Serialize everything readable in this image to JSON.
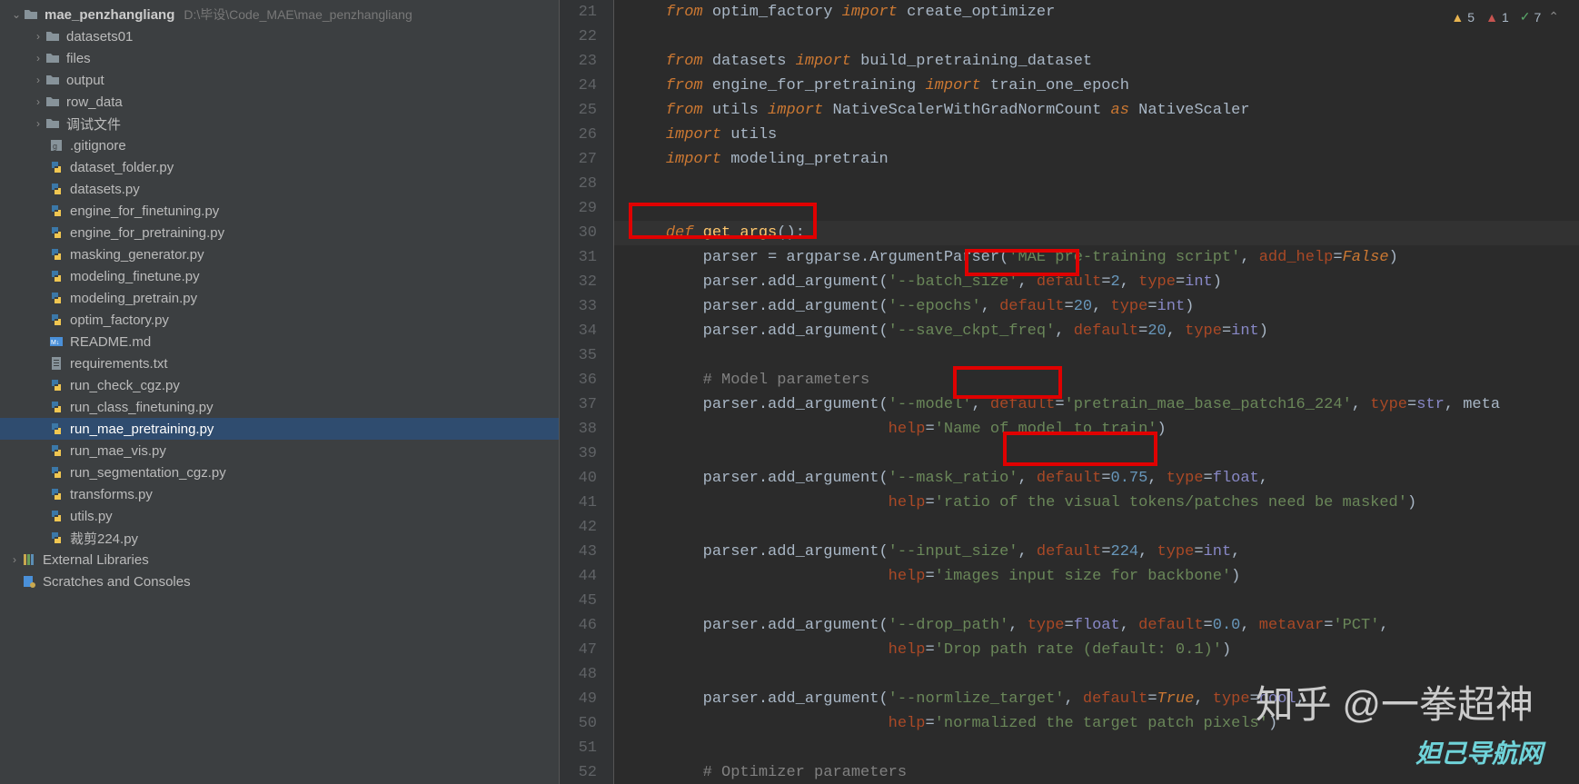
{
  "project": {
    "name": "mae_penzhangliang",
    "path": "D:\\毕设\\Code_MAE\\mae_penzhangliang"
  },
  "tree": [
    {
      "type": "folder",
      "name": "datasets01",
      "depth": 1,
      "open": false
    },
    {
      "type": "folder",
      "name": "files",
      "depth": 1,
      "open": false
    },
    {
      "type": "folder",
      "name": "output",
      "depth": 1,
      "open": false
    },
    {
      "type": "folder",
      "name": "row_data",
      "depth": 1,
      "open": false
    },
    {
      "type": "folder",
      "name": "调试文件",
      "depth": 1,
      "open": false
    },
    {
      "type": "file",
      "name": ".gitignore",
      "depth": 2,
      "icon": "git"
    },
    {
      "type": "file",
      "name": "dataset_folder.py",
      "depth": 2,
      "icon": "py"
    },
    {
      "type": "file",
      "name": "datasets.py",
      "depth": 2,
      "icon": "py"
    },
    {
      "type": "file",
      "name": "engine_for_finetuning.py",
      "depth": 2,
      "icon": "py"
    },
    {
      "type": "file",
      "name": "engine_for_pretraining.py",
      "depth": 2,
      "icon": "py"
    },
    {
      "type": "file",
      "name": "masking_generator.py",
      "depth": 2,
      "icon": "py"
    },
    {
      "type": "file",
      "name": "modeling_finetune.py",
      "depth": 2,
      "icon": "py"
    },
    {
      "type": "file",
      "name": "modeling_pretrain.py",
      "depth": 2,
      "icon": "py"
    },
    {
      "type": "file",
      "name": "optim_factory.py",
      "depth": 2,
      "icon": "py"
    },
    {
      "type": "file",
      "name": "README.md",
      "depth": 2,
      "icon": "md"
    },
    {
      "type": "file",
      "name": "requirements.txt",
      "depth": 2,
      "icon": "txt"
    },
    {
      "type": "file",
      "name": "run_check_cgz.py",
      "depth": 2,
      "icon": "py"
    },
    {
      "type": "file",
      "name": "run_class_finetuning.py",
      "depth": 2,
      "icon": "py"
    },
    {
      "type": "file",
      "name": "run_mae_pretraining.py",
      "depth": 2,
      "icon": "py",
      "selected": true
    },
    {
      "type": "file",
      "name": "run_mae_vis.py",
      "depth": 2,
      "icon": "py"
    },
    {
      "type": "file",
      "name": "run_segmentation_cgz.py",
      "depth": 2,
      "icon": "py"
    },
    {
      "type": "file",
      "name": "transforms.py",
      "depth": 2,
      "icon": "py"
    },
    {
      "type": "file",
      "name": "utils.py",
      "depth": 2,
      "icon": "py"
    },
    {
      "type": "file",
      "name": "裁剪224.py",
      "depth": 2,
      "icon": "py"
    }
  ],
  "tree_tail": [
    {
      "name": "External Libraries",
      "icon": "lib"
    },
    {
      "name": "Scratches and Consoles",
      "icon": "scratch"
    }
  ],
  "status": {
    "warn": "5",
    "err": "1",
    "ok": "7"
  },
  "lines": {
    "start": 21,
    "count": 32
  },
  "code": {
    "l21a": "    ",
    "l21b": "from",
    "l21c": " optim_factory ",
    "l21d": "import",
    "l21e": " create_optimizer",
    "l23a": "    ",
    "l23b": "from",
    "l23c": " datasets ",
    "l23d": "import",
    "l23e": " build_pretraining_dataset",
    "l24a": "    ",
    "l24b": "from",
    "l24c": " engine_for_pretraining ",
    "l24d": "import",
    "l24e": " train_one_epoch",
    "l25a": "    ",
    "l25b": "from",
    "l25c": " utils ",
    "l25d": "import",
    "l25e": " NativeScalerWithGradNormCount ",
    "l25f": "as",
    "l25g": " NativeScaler",
    "l26a": "    ",
    "l26b": "import",
    "l26c": " utils",
    "l27a": "    ",
    "l27b": "import",
    "l27c": " modeling_pretrain",
    "l30a": "    ",
    "l30b": "def ",
    "l30c": "get_args",
    "l30d": "():",
    "l31a": "        parser = argparse.ArgumentParser(",
    "l31b": "'MAE pre-training script'",
    "l31c": ", ",
    "l31d": "add_help",
    "l31e": "=",
    "l31f": "False",
    "l31g": ")",
    "l32a": "        parser.add_argument(",
    "l32b": "'--batch_size'",
    "l32c": ", ",
    "l32d": "default",
    "l32e": "=",
    "l32f": "2",
    "l32g": ", ",
    "l32h": "type",
    "l32i": "=",
    "l32j": "int",
    "l32k": ")",
    "l33a": "        parser.add_argument(",
    "l33b": "'--epochs'",
    "l33c": ", ",
    "l33d": "default",
    "l33e": "=",
    "l33f": "20",
    "l33g": ", ",
    "l33h": "type",
    "l33i": "=",
    "l33j": "int",
    "l33k": ")",
    "l34a": "        parser.add_argument(",
    "l34b": "'--save_ckpt_freq'",
    "l34c": ", ",
    "l34d": "default",
    "l34e": "=",
    "l34f": "20",
    "l34g": ", ",
    "l34h": "type",
    "l34i": "=",
    "l34j": "int",
    "l34k": ")",
    "l36a": "        ",
    "l36b": "# Model parameters",
    "l37a": "        parser.add_argument(",
    "l37b": "'--model'",
    "l37c": ", ",
    "l37d": "default",
    "l37e": "=",
    "l37f": "'pretrain_mae_base_patch16_224'",
    "l37g": ", ",
    "l37h": "type",
    "l37i": "=",
    "l37j": "str",
    "l37k": ", meta",
    "l38a": "                            ",
    "l38b": "help",
    "l38c": "=",
    "l38d": "'Name of model to train'",
    "l38e": ")",
    "l40a": "        parser.add_argument(",
    "l40b": "'--mask_ratio'",
    "l40c": ", ",
    "l40d": "default",
    "l40e": "=",
    "l40f": "0.75",
    "l40g": ", ",
    "l40h": "type",
    "l40i": "=",
    "l40j": "float",
    "l40k": ",",
    "l41a": "                            ",
    "l41b": "help",
    "l41c": "=",
    "l41d": "'ratio of the visual tokens/patches need be masked'",
    "l41e": ")",
    "l43a": "        parser.add_argument(",
    "l43b": "'--input_size'",
    "l43c": ", ",
    "l43d": "default",
    "l43e": "=",
    "l43f": "224",
    "l43g": ", ",
    "l43h": "type",
    "l43i": "=",
    "l43j": "int",
    "l43k": ",",
    "l44a": "                            ",
    "l44b": "help",
    "l44c": "=",
    "l44d": "'images input size for backbone'",
    "l44e": ")",
    "l46a": "        parser.add_argument(",
    "l46b": "'--drop_path'",
    "l46c": ", ",
    "l46d": "type",
    "l46e": "=",
    "l46f": "float",
    "l46g": ", ",
    "l46h": "default",
    "l46i": "=",
    "l46j": "0.0",
    "l46k": ", ",
    "l46l": "metavar",
    "l46m": "=",
    "l46n": "'PCT'",
    "l46o": ",",
    "l47a": "                            ",
    "l47b": "help",
    "l47c": "=",
    "l47d": "'Drop path rate (default: 0.1)'",
    "l47e": ")",
    "l49a": "        parser.add_argument(",
    "l49b": "'--normlize_target'",
    "l49c": ", ",
    "l49d": "default",
    "l49e": "=",
    "l49f": "True",
    "l49g": ", ",
    "l49h": "type",
    "l49i": "=",
    "l49j": "bool",
    "l49k": ",",
    "l50a": "                            ",
    "l50b": "help",
    "l50c": "=",
    "l50d": "'normalized the target patch pixels'",
    "l50e": ")",
    "l52a": "        ",
    "l52b": "# Optimizer parameters"
  },
  "watermark1": "知乎 @一拳超神",
  "watermark2": "妲己导航网"
}
